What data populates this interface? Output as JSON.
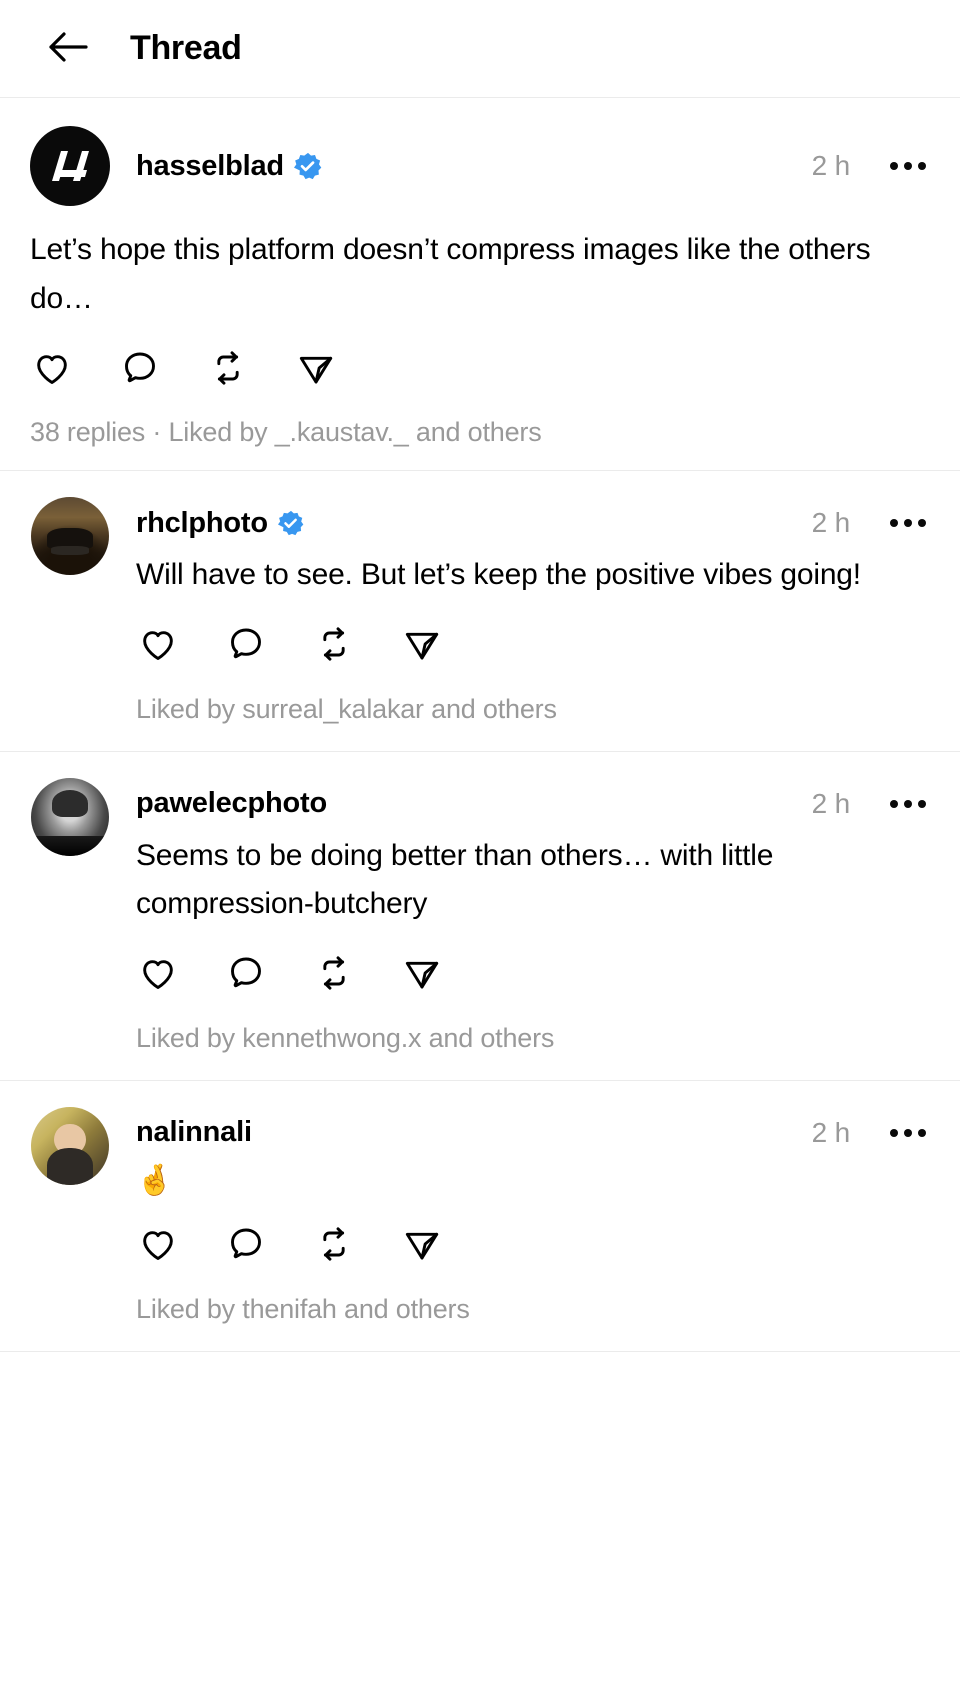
{
  "header": {
    "back_icon": "back-arrow-icon",
    "title": "Thread"
  },
  "icons": {
    "like": "heart-icon",
    "comment": "comment-bubble-icon",
    "repost": "repost-icon",
    "share": "share-paper-plane-icon",
    "more": "more-options-icon",
    "verified": "verified-badge-icon"
  },
  "colors": {
    "verified_blue": "#3897f0",
    "muted_text": "#999999",
    "primary_text": "#000000",
    "divider": "#ebebeb",
    "background": "#ffffff"
  },
  "root_post": {
    "avatar": "hasselblad-logo-avatar",
    "username": "hasselblad",
    "verified": true,
    "timestamp": "2 h",
    "text": "Let’s hope this platform doesn’t compress images like the others do…",
    "footer": "38 replies · Liked by _.kaustav._ and others"
  },
  "replies": [
    {
      "avatar": "rhclphoto-photo-avatar",
      "username": "rhclphoto",
      "verified": true,
      "timestamp": "2 h",
      "text": "Will have to see. But let’s keep the positive vibes going!",
      "liked_by": "Liked by surreal_kalakar and others"
    },
    {
      "avatar": "pawelecphoto-photo-avatar",
      "username": "pawelecphoto",
      "verified": false,
      "timestamp": "2 h",
      "text": "Seems to be doing better than others… with little compression-butchery",
      "liked_by": "Liked by kennethwong.x and others"
    },
    {
      "avatar": "nalinnali-photo-avatar",
      "username": "nalinnali",
      "verified": false,
      "timestamp": "2 h",
      "text": "🤞",
      "liked_by": "Liked by thenifah and others"
    }
  ]
}
